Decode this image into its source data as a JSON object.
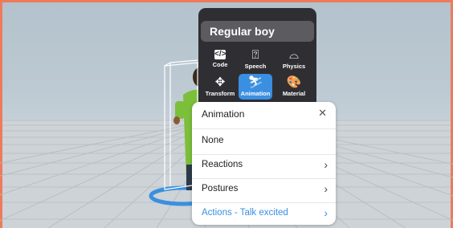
{
  "object_name": "Regular boy",
  "toolbar": {
    "tools": [
      {
        "label": "Code",
        "icon": "code-icon",
        "glyph": "</>"
      },
      {
        "label": "Speech",
        "icon": "speech-bubble-icon",
        "glyph": "⍰"
      },
      {
        "label": "Physics",
        "icon": "physics-icon",
        "glyph": "⌓"
      },
      {
        "label": "Transform",
        "icon": "move-arrows-icon",
        "glyph": "✥"
      },
      {
        "label": "Animation",
        "icon": "animation-icon",
        "glyph": "⛷",
        "active": true
      },
      {
        "label": "Material",
        "icon": "palette-icon",
        "glyph": "🎨"
      }
    ]
  },
  "animation_menu": {
    "title": "Animation",
    "close_glyph": "✕",
    "items": [
      {
        "label": "None",
        "has_submenu": false
      },
      {
        "label": "Reactions",
        "has_submenu": true
      },
      {
        "label": "Postures",
        "has_submenu": true
      },
      {
        "label": "Actions - Talk excited",
        "has_submenu": true,
        "active": true
      }
    ],
    "chevron_glyph": "›"
  },
  "colors": {
    "accent": "#3a8fe0",
    "frame": "#ee7a5c",
    "panel": "#2f2f33"
  }
}
